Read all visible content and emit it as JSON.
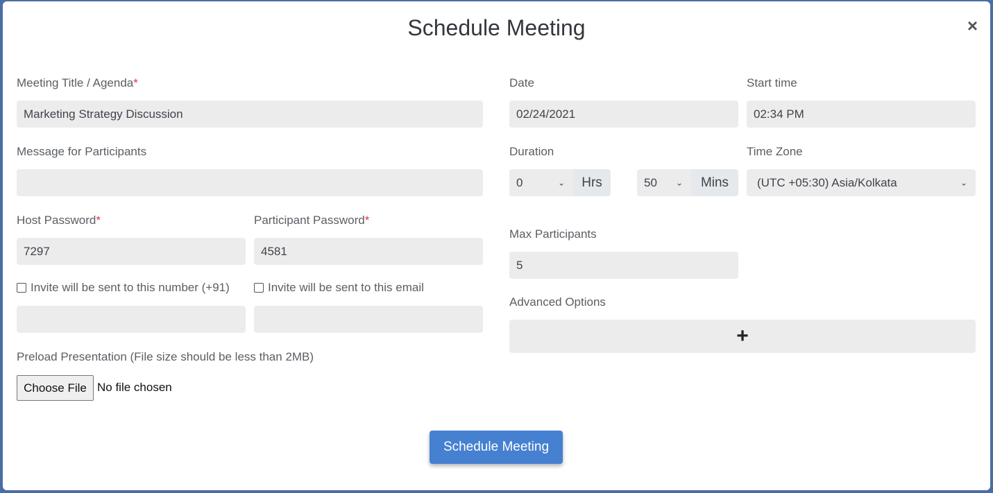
{
  "modal": {
    "title": "Schedule Meeting",
    "close_icon": "×"
  },
  "form": {
    "meeting_title": {
      "label": "Meeting Title / Agenda",
      "required": "*",
      "value": "Marketing Strategy Discussion"
    },
    "message": {
      "label": "Message for Participants",
      "value": ""
    },
    "host_password": {
      "label": "Host Password",
      "required": "*",
      "value": "7297"
    },
    "participant_password": {
      "label": "Participant Password",
      "required": "*",
      "value": "4581"
    },
    "invite_number": {
      "label": "Invite will be sent to this number (+91)",
      "checked": false,
      "value": ""
    },
    "invite_email": {
      "label": "Invite will be sent to this email",
      "checked": false,
      "value": ""
    },
    "preload": {
      "label": "Preload Presentation (File size should be less than 2MB)",
      "button": "Choose File",
      "status": "No file chosen"
    },
    "date": {
      "label": "Date",
      "value": "02/24/2021"
    },
    "start_time": {
      "label": "Start time",
      "value": "02:34 PM"
    },
    "duration": {
      "label": "Duration",
      "hours_value": "0",
      "hours_unit": "Hrs",
      "mins_value": "50",
      "mins_unit": "Mins"
    },
    "time_zone": {
      "label": "Time Zone",
      "value": "(UTC +05:30) Asia/Kolkata"
    },
    "max_participants": {
      "label": "Max Participants",
      "value": "5"
    },
    "advanced": {
      "label": "Advanced Options",
      "icon": "+"
    },
    "submit": "Schedule Meeting"
  },
  "icons": {
    "chevron": "⌄"
  }
}
